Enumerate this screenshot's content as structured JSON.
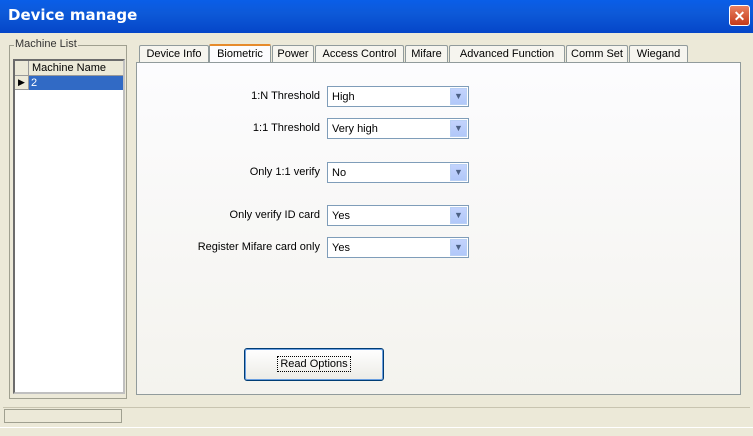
{
  "window": {
    "title": "Device manage",
    "close": "✕"
  },
  "machine_list": {
    "group_label": "Machine List",
    "column_header": "Machine Name",
    "rows": [
      {
        "indicator": "▶",
        "name": "2"
      }
    ]
  },
  "tabs": [
    {
      "label": "Device Info"
    },
    {
      "label": "Biometric"
    },
    {
      "label": "Power"
    },
    {
      "label": "Access Control"
    },
    {
      "label": "Mifare"
    },
    {
      "label": "Advanced Function"
    },
    {
      "label": "Comm Set"
    },
    {
      "label": "Wiegand"
    }
  ],
  "active_tab": "Biometric",
  "fields": [
    {
      "label": "1:N Threshold",
      "value": "High"
    },
    {
      "label": "1:1 Threshold",
      "value": "Very high"
    },
    {
      "label": "Only 1:1 verify",
      "value": "No"
    },
    {
      "label": "Only verify ID card",
      "value": "Yes"
    },
    {
      "label": "Register Mifare card only",
      "value": "Yes"
    }
  ],
  "read_button": "Read Options",
  "icons": {
    "dropdown": "chevron-down-icon",
    "close": "close-icon",
    "row_pointer": "row-pointer-icon"
  }
}
